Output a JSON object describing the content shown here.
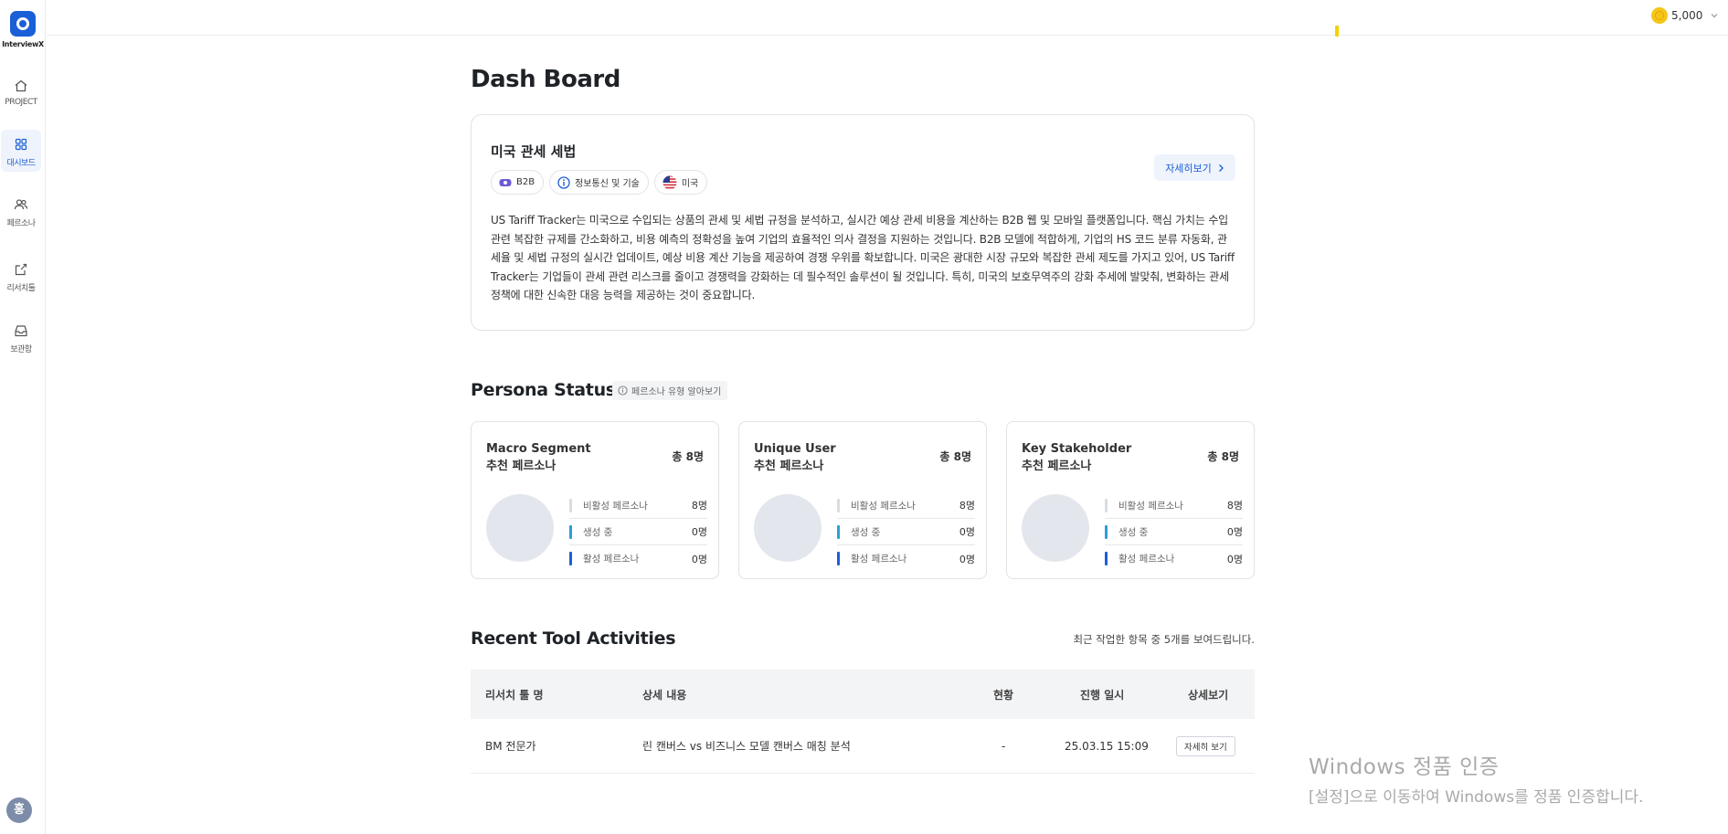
{
  "app": {
    "logo_text": "InterviewX"
  },
  "sidebar": {
    "items": [
      {
        "label": "PROJECT",
        "icon": "home-icon"
      },
      {
        "label": "대시보드",
        "icon": "dashboard-grid-icon",
        "active": true
      },
      {
        "label": "페르소나",
        "icon": "users-icon"
      },
      {
        "label": "리서치툴",
        "icon": "edit-box-icon"
      },
      {
        "label": "보관함",
        "icon": "inbox-icon"
      }
    ],
    "avatar_initial": "홍"
  },
  "topbar": {
    "credit_amount": "5,000",
    "coin_icon": "coin-icon",
    "bell_icon": "bell-icon",
    "marker_color": "#f4d000"
  },
  "page": {
    "title": "Dash Board"
  },
  "project": {
    "name": "미국 관세 세법",
    "tags": [
      {
        "label": "B2B",
        "icon": "b2b-icon"
      },
      {
        "label": "정보통신 및 기술",
        "icon": "info-icon"
      },
      {
        "label": "미국",
        "icon": "us-flag-icon"
      }
    ],
    "detail_button": "자세히보기",
    "description": "US Tariff Tracker는 미국으로 수입되는 상품의 관세 및 세법 규정을 분석하고, 실시간 예상 관세 비용을 계산하는 B2B 웹 및 모바일 플랫폼입니다. 핵심 가치는 수입 관련 복잡한 규제를 간소화하고, 비용 예측의 정확성을 높여 기업의 효율적인 의사 결정을 지원하는 것입니다. B2B 모델에 적합하게, 기업의 HS 코드 분류 자동화, 관세율 및 세법 규정의 실시간 업데이트, 예상 비용 계산 기능을 제공하여 경쟁 우위를 확보합니다. 미국은 광대한 시장 규모와 복잡한 관세 제도를 가지고 있어, US Tariff Tracker는 기업들이 관세 관련 리스크를 줄이고 경쟁력을 강화하는 데 필수적인 솔루션이 될 것입니다. 특히, 미국의 보호무역주의 강화 추세에 발맞춰, 변화하는 관세 정책에 대한 신속한 대응 능력을 제공하는 것이 중요합니다."
  },
  "persona": {
    "title": "Persona Status",
    "help_label": "페르소나 유형 알아보기",
    "cards": [
      {
        "title_line1": "Macro Segment",
        "title_line2": "추천 페르소나",
        "total": "총 8명",
        "stats": [
          {
            "label": "비활성 페르소나",
            "value": "8명",
            "color": "#d8dce3"
          },
          {
            "label": "생성 중",
            "value": "0명",
            "color": "#2a9fd6"
          },
          {
            "label": "활성 페르소나",
            "value": "0명",
            "color": "#1b5fd6"
          }
        ]
      },
      {
        "title_line1": "Unique User",
        "title_line2": "추천 페르소나",
        "total": "총 8명",
        "stats": [
          {
            "label": "비활성 페르소나",
            "value": "8명",
            "color": "#d8dce3"
          },
          {
            "label": "생성 중",
            "value": "0명",
            "color": "#2a9fd6"
          },
          {
            "label": "활성 페르소나",
            "value": "0명",
            "color": "#1b5fd6"
          }
        ]
      },
      {
        "title_line1": "Key Stakeholder",
        "title_line2": "추천 페르소나",
        "total": "총 8명",
        "stats": [
          {
            "label": "비활성 페르소나",
            "value": "8명",
            "color": "#d8dce3"
          },
          {
            "label": "생성 중",
            "value": "0명",
            "color": "#2a9fd6"
          },
          {
            "label": "활성 페르소나",
            "value": "0명",
            "color": "#1b5fd6"
          }
        ]
      }
    ]
  },
  "activities": {
    "title": "Recent Tool Activities",
    "note": "최근 작업한 항목 중 5개를 보여드립니다.",
    "columns": [
      "리서치 툴 명",
      "상세 내용",
      "현황",
      "진행 일시",
      "상세보기"
    ],
    "rows": [
      {
        "tool": "BM 전문가",
        "detail": "린 캔버스 vs 비즈니스 모델 캔버스 매칭 분석",
        "status": "-",
        "date": "25.03.15 15:09",
        "view": "자세히 보기"
      }
    ]
  },
  "watermark": {
    "line1": "Windows 정품 인증",
    "line2": "[설정]으로 이동하여 Windows를 정품 인증합니다."
  }
}
